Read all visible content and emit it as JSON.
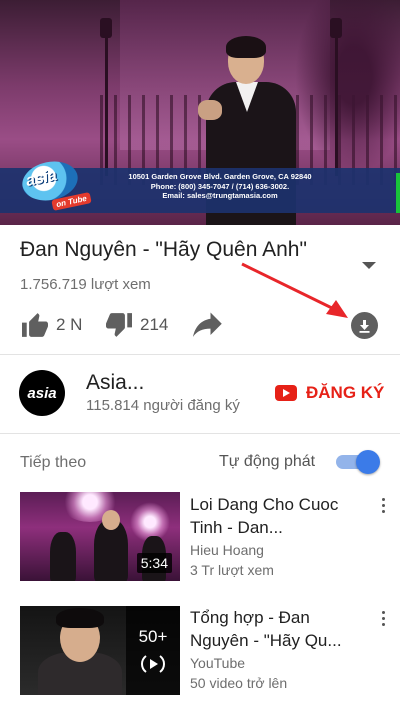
{
  "player": {
    "banner_lines": "10501 Garden Grove Blvd. Garden Grove, CA 92840\nPhone: (800) 345-7047 / (714) 636-3002.\nEmail: sales@trungtamasia.com",
    "logo_word": "asia",
    "logo_ribbon": "on Tube"
  },
  "video": {
    "title": "Đan Nguyên - \"Hãy Quên Anh\"",
    "views": "1.756.719 lượt xem",
    "likes": "2 N",
    "dislikes": "214"
  },
  "channel": {
    "avatar_text": "asia",
    "name": "Asia...",
    "subscribers": "115.814 người đăng ký",
    "subscribe_label": "ĐĂNG KÝ"
  },
  "up_next": {
    "heading": "Tiếp theo",
    "autoplay_label": "Tự động phát",
    "autoplay_on": true,
    "items": [
      {
        "title": "Loi Dang Cho Cuoc\nTinh - Dan...",
        "channel": "Hieu Hoang",
        "meta": "3 Tr lượt xem",
        "duration": "5:34"
      },
      {
        "title": "Tổng hợp - Đan\nNguyên - \"Hãy Qu...",
        "channel": "YouTube",
        "meta": "50 video trở lên",
        "playlist_count": "50+"
      }
    ]
  },
  "colors": {
    "accent_red": "#e62117",
    "toggle_blue": "#3b7be8",
    "annotation_arrow": "#e8262a"
  },
  "icons": {
    "like": "thumbs-up-icon",
    "dislike": "thumbs-down-icon",
    "share": "share-arrow-icon",
    "download": "download-icon",
    "more": "more-vertical-icon",
    "playlist": "playlist-play-icon"
  }
}
